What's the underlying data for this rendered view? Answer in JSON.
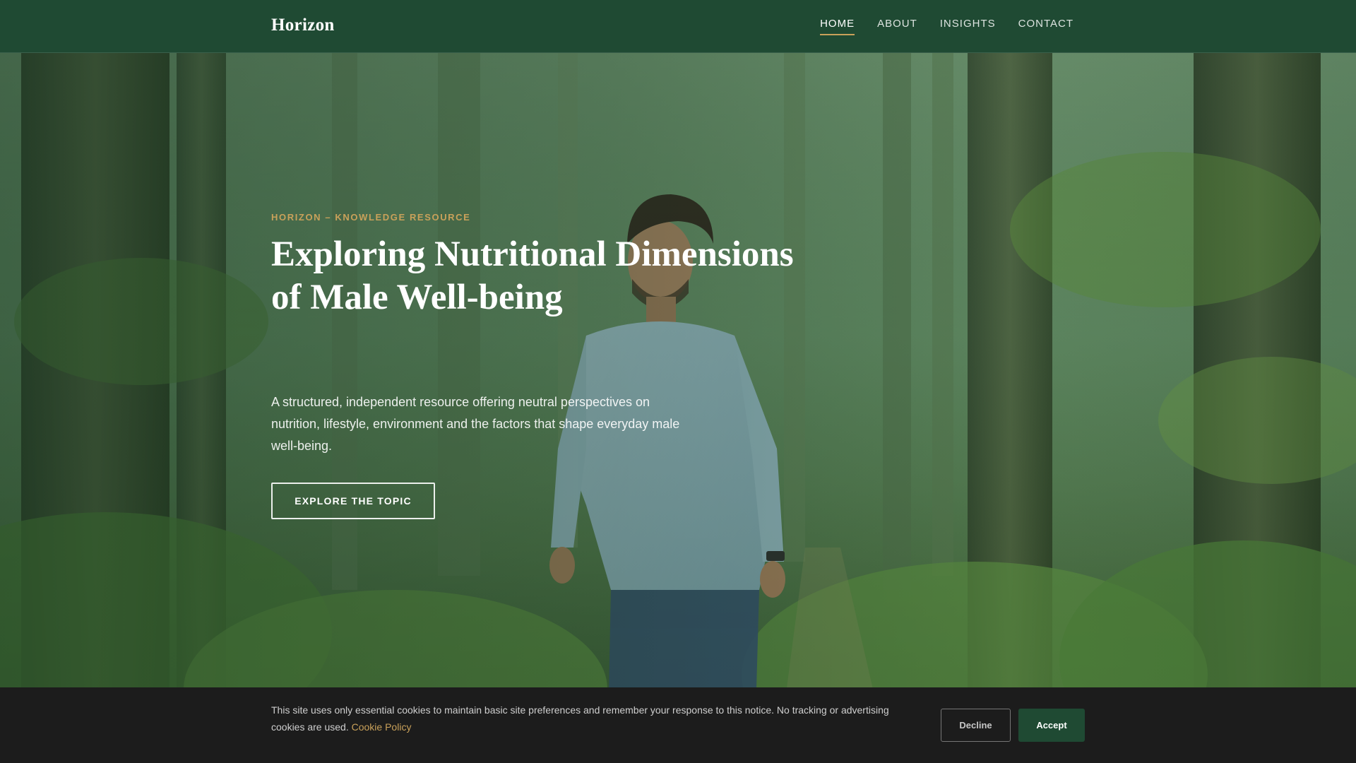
{
  "header": {
    "brand": "Horizon",
    "nav": [
      {
        "label": "HOME",
        "active": true
      },
      {
        "label": "ABOUT",
        "active": false
      },
      {
        "label": "INSIGHTS",
        "active": false
      },
      {
        "label": "CONTACT",
        "active": false
      }
    ]
  },
  "hero": {
    "eyebrow": "HORIZON – KNOWLEDGE RESOURCE",
    "title": "Exploring Nutritional Dimensions of Male Well-being",
    "lead": "A structured, independent resource offering neutral perspectives on nutrition, lifestyle, environment and the factors that shape everyday male well-being.",
    "cta_label": "EXPLORE THE TOPIC"
  },
  "cookie": {
    "text": "This site uses only essential cookies to maintain basic site preferences and remember your response to this notice. No tracking or advertising cookies are used.",
    "link_label": "Cookie Policy",
    "decline_label": "Decline",
    "accept_label": "Accept"
  },
  "colors": {
    "header_bg": "#1f4a33",
    "accent_gold": "#c9a15a",
    "cookie_bg": "#1c1c1c",
    "accept_bg": "#1f4a33"
  }
}
